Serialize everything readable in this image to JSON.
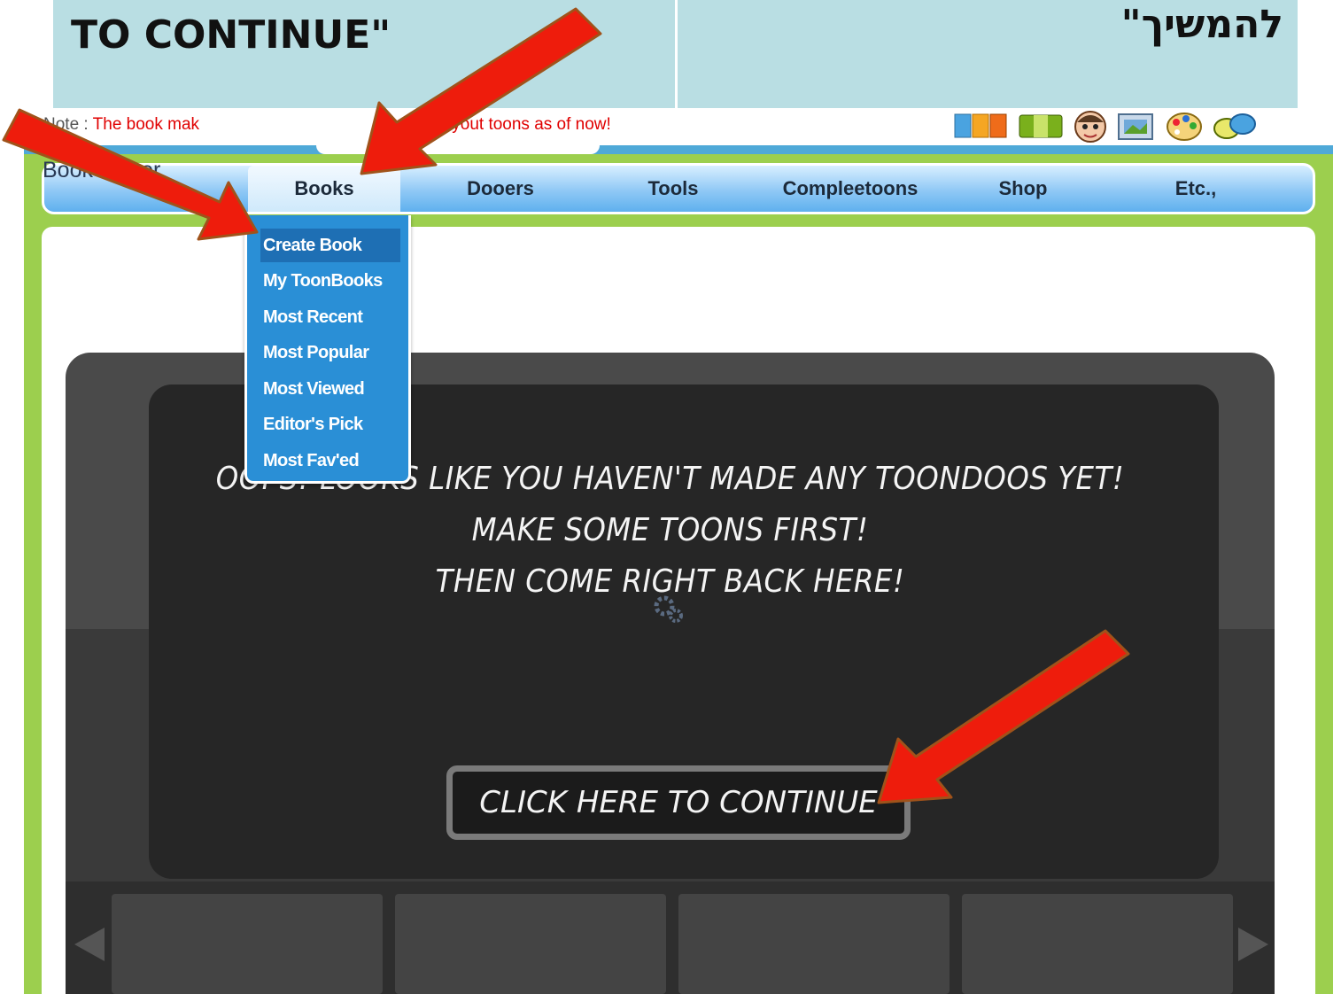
{
  "banner": {
    "left_text": "TO CONTINUE\"",
    "right_text": "להמשיך\""
  },
  "nav": {
    "items": [
      "Books",
      "Dooers",
      "Tools",
      "Compleetoons",
      "Shop",
      "Etc.,"
    ],
    "active": "Books"
  },
  "dropdown": {
    "items": [
      "Create Book",
      "My ToonBooks",
      "Most Recent",
      "Most Popular",
      "Most Viewed",
      "Editor's Pick",
      "Most Fav'ed"
    ],
    "selected": "Create Book"
  },
  "note": {
    "label": "Note :",
    "text_start": "The book mak",
    "text_end": "vertical layout toons as of now!"
  },
  "page_title": "Book Maker",
  "toolbar_icons": [
    "layout-icon",
    "book-icon",
    "character-face-icon",
    "photo-icon",
    "paint-palette-icon",
    "text-bubble-icon"
  ],
  "flash": {
    "message_line1": "OOPS! LOOKS LIKE YOU HAVEN'T MADE ANY TOONDOOS YET!",
    "message_line2": "MAKE SOME TOONS FIRST!",
    "message_line3": "THEN COME RIGHT BACK HERE!",
    "continue_label": "CLICK HERE TO CONTINUE"
  },
  "colors": {
    "banner_bg": "#b9dee3",
    "site_green": "#9ccf4e",
    "nav_blue": "#8fc8f5",
    "dropdown_blue": "#2a8fd6",
    "note_red": "#e00000",
    "arrow_red": "#ee1c0c"
  }
}
